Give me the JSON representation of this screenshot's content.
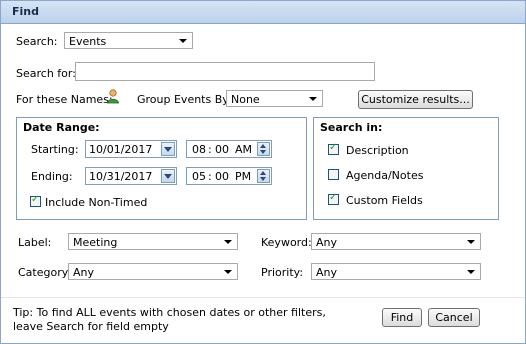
{
  "dialog": {
    "title": "Find"
  },
  "search": {
    "label": "Search:",
    "value": "Events"
  },
  "search_for": {
    "label": "Search for:",
    "value": "",
    "placeholder": ""
  },
  "names": {
    "label": "For these Names:"
  },
  "group_by": {
    "label": "Group Events By:",
    "value": "None"
  },
  "customize_button": "Customize results...",
  "date_range": {
    "title": "Date Range:",
    "starting_label": "Starting:",
    "starting_date": "10/01/2017",
    "starting_hour": "08",
    "starting_minute": "00",
    "starting_ampm": "AM",
    "ending_label": "Ending:",
    "ending_date": "10/31/2017",
    "ending_hour": "05",
    "ending_minute": "00",
    "ending_ampm": "PM",
    "time_sep": ":",
    "include_non_timed": {
      "label": "Include Non-Timed",
      "checked": true
    }
  },
  "search_in": {
    "title": "Search in:",
    "options": [
      {
        "label": "Description",
        "checked": true
      },
      {
        "label": "Agenda/Notes",
        "checked": false
      },
      {
        "label": "Custom Fields",
        "checked": true
      }
    ]
  },
  "filters": {
    "label": {
      "label": "Label:",
      "value": "Meeting"
    },
    "keyword": {
      "label": "Keyword:",
      "value": "Any"
    },
    "category": {
      "label": "Category:",
      "value": "Any"
    },
    "priority": {
      "label": "Priority:",
      "value": "Any"
    }
  },
  "tip": "Tip: To find ALL events with chosen dates or other filters, leave Search for field empty",
  "buttons": {
    "find": "Find",
    "cancel": "Cancel"
  },
  "check_glyph": "✓",
  "icons": {
    "names_icon": "user-icon",
    "calendar_dropdown": "chevron-down-icon",
    "spinner": "spinner-icon"
  }
}
